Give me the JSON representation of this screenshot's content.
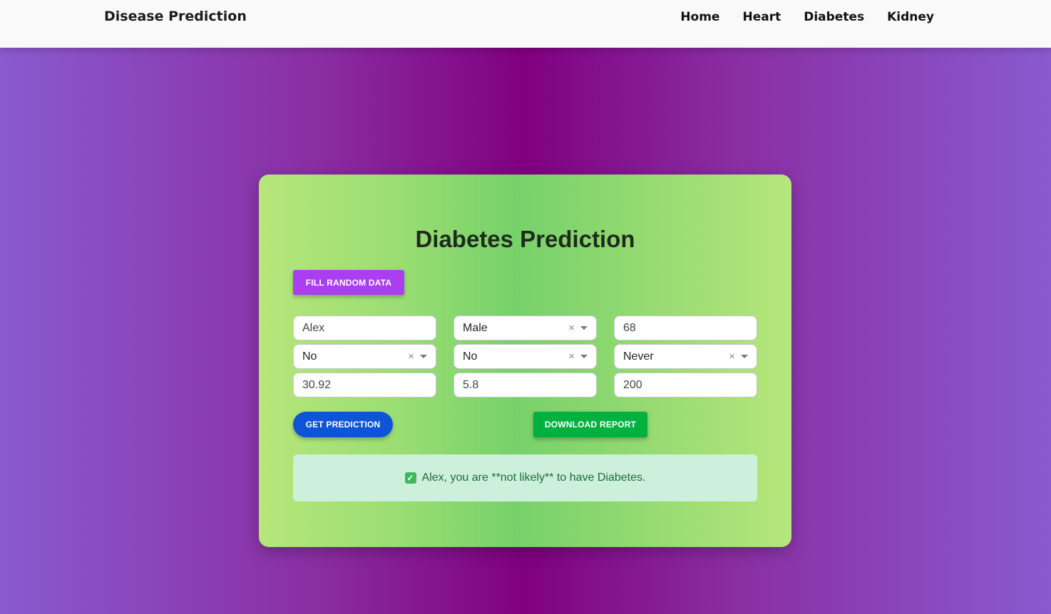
{
  "navbar": {
    "brand": "Disease Prediction",
    "links": [
      "Home",
      "Heart",
      "Diabetes",
      "Kidney"
    ]
  },
  "card": {
    "title": "Diabetes Prediction",
    "fill_random_label": "Fill Random Data",
    "get_prediction_label": "Get Prediction",
    "download_report_label": "Download Report"
  },
  "form": {
    "name": "Alex",
    "gender": "Male",
    "age": "68",
    "hypertension": "No",
    "heart_disease": "No",
    "smoking_history": "Never",
    "bmi": "30.92",
    "hba1c_level": "5.8",
    "blood_glucose_level": "200"
  },
  "result": {
    "icon": "check-icon",
    "message": "Alex, you are **not likely** to have Diabetes."
  },
  "colors": {
    "fill_random_button": "#a93ff0",
    "get_prediction_button": "#0d54d6",
    "download_report_button": "#00b140",
    "result_background": "#cdf0dc"
  }
}
